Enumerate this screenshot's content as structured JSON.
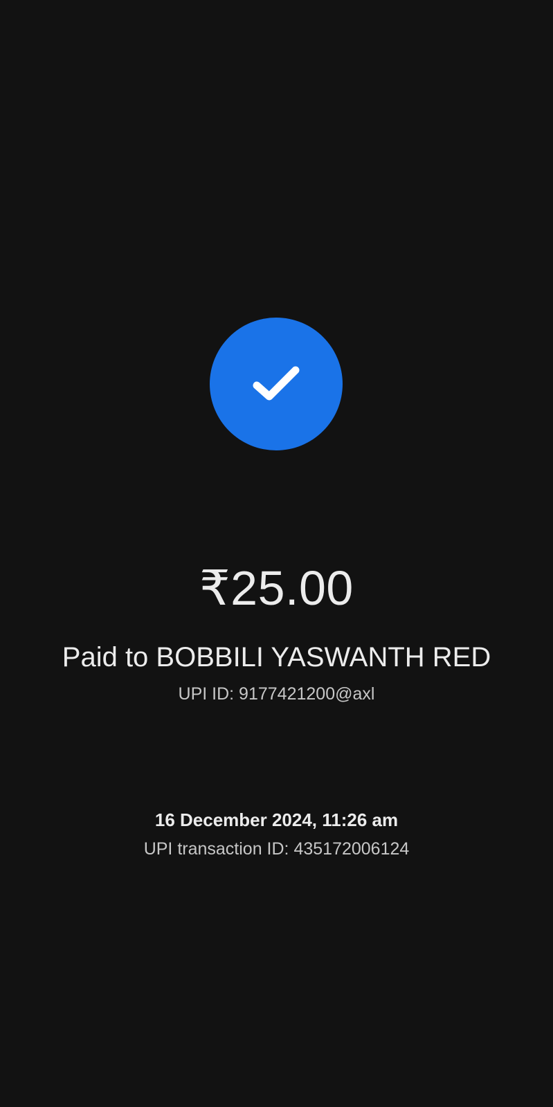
{
  "payment": {
    "status_icon": "check-icon",
    "status_color": "#1a73e8",
    "amount": "₹25.00",
    "payee_line": "Paid to BOBBILI YASWANTH RED",
    "upi_id_line": "UPI ID: 9177421200@axl",
    "datetime": "16 December 2024, 11:26 am",
    "transaction_line": "UPI transaction ID: 435172006124"
  },
  "theme": {
    "background": "#121212",
    "text_primary": "#ececec",
    "text_secondary": "#c7c7c7"
  }
}
